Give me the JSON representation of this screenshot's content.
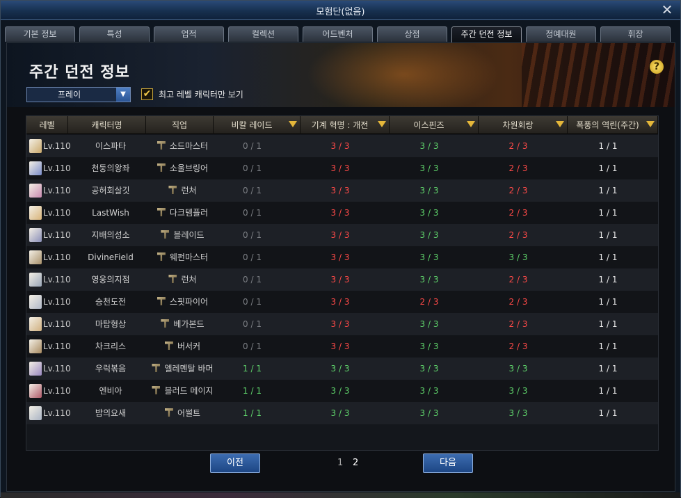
{
  "window": {
    "title": "모험단(없음)",
    "close_glyph": "✕"
  },
  "tabs": [
    {
      "label": "기본 정보",
      "active": false
    },
    {
      "label": "특성",
      "active": false
    },
    {
      "label": "업적",
      "active": false
    },
    {
      "label": "컬렉션",
      "active": false
    },
    {
      "label": "어드벤처",
      "active": false
    },
    {
      "label": "상점",
      "active": false
    },
    {
      "label": "주간 던전 정보",
      "active": true
    },
    {
      "label": "정예대원",
      "active": false
    },
    {
      "label": "휘장",
      "active": false
    }
  ],
  "panel": {
    "title": "주간 던전 정보",
    "help_glyph": "?",
    "server_dropdown": {
      "selected": "프레이",
      "arrow_glyph": "▼"
    },
    "checkbox": {
      "label": "최고 레벨 캐릭터만 보기",
      "checked": true,
      "check_glyph": "✔"
    }
  },
  "table": {
    "headers": [
      {
        "label": "레벨",
        "sortable": false
      },
      {
        "label": "캐릭터명",
        "sortable": false
      },
      {
        "label": "직업",
        "sortable": false
      },
      {
        "label": "비칼 레이드",
        "sortable": true
      },
      {
        "label": "기계 혁명 : 개전",
        "sortable": true
      },
      {
        "label": "이스핀즈",
        "sortable": true
      },
      {
        "label": "차원회랑",
        "sortable": true
      },
      {
        "label": "폭풍의 역린(주간)",
        "sortable": true
      }
    ],
    "rows": [
      {
        "level": "Lv.110",
        "name": "이스파타",
        "job": "소드마스터",
        "avatar_color": "#c9a86a",
        "vals": [
          {
            "t": "0 / 1",
            "c": "gray"
          },
          {
            "t": "3 / 3",
            "c": "red"
          },
          {
            "t": "3 / 3",
            "c": "green"
          },
          {
            "t": "2 / 3",
            "c": "red"
          },
          {
            "t": "1 / 1",
            "c": "white"
          }
        ]
      },
      {
        "level": "Lv.110",
        "name": "천둥의왕좌",
        "job": "소울브링어",
        "avatar_color": "#7a8cc9",
        "vals": [
          {
            "t": "0 / 1",
            "c": "gray"
          },
          {
            "t": "3 / 3",
            "c": "red"
          },
          {
            "t": "3 / 3",
            "c": "green"
          },
          {
            "t": "2 / 3",
            "c": "red"
          },
          {
            "t": "1 / 1",
            "c": "white"
          }
        ]
      },
      {
        "level": "Lv.110",
        "name": "공허회살깃",
        "job": "런처",
        "avatar_color": "#c98ab0",
        "vals": [
          {
            "t": "0 / 1",
            "c": "gray"
          },
          {
            "t": "3 / 3",
            "c": "red"
          },
          {
            "t": "3 / 3",
            "c": "green"
          },
          {
            "t": "2 / 3",
            "c": "red"
          },
          {
            "t": "1 / 1",
            "c": "white"
          }
        ]
      },
      {
        "level": "Lv.110",
        "name": "LastWish",
        "job": "다크템플러",
        "avatar_color": "#d8b47a",
        "vals": [
          {
            "t": "0 / 1",
            "c": "gray"
          },
          {
            "t": "3 / 3",
            "c": "red"
          },
          {
            "t": "3 / 3",
            "c": "green"
          },
          {
            "t": "2 / 3",
            "c": "red"
          },
          {
            "t": "1 / 1",
            "c": "white"
          }
        ]
      },
      {
        "level": "Lv.110",
        "name": "지배의성소",
        "job": "블레이드",
        "avatar_color": "#8a8fb8",
        "vals": [
          {
            "t": "0 / 1",
            "c": "gray"
          },
          {
            "t": "3 / 3",
            "c": "red"
          },
          {
            "t": "3 / 3",
            "c": "green"
          },
          {
            "t": "2 / 3",
            "c": "red"
          },
          {
            "t": "1 / 1",
            "c": "white"
          }
        ]
      },
      {
        "level": "Lv.110",
        "name": "DivineField",
        "job": "웨펀마스터",
        "avatar_color": "#a8906a",
        "vals": [
          {
            "t": "0 / 1",
            "c": "gray"
          },
          {
            "t": "3 / 3",
            "c": "red"
          },
          {
            "t": "3 / 3",
            "c": "green"
          },
          {
            "t": "3 / 3",
            "c": "green"
          },
          {
            "t": "1 / 1",
            "c": "white"
          }
        ]
      },
      {
        "level": "Lv.110",
        "name": "영웅의지점",
        "job": "런처",
        "avatar_color": "#9aa6b8",
        "vals": [
          {
            "t": "0 / 1",
            "c": "gray"
          },
          {
            "t": "3 / 3",
            "c": "red"
          },
          {
            "t": "3 / 3",
            "c": "green"
          },
          {
            "t": "2 / 3",
            "c": "red"
          },
          {
            "t": "1 / 1",
            "c": "white"
          }
        ]
      },
      {
        "level": "Lv.110",
        "name": "승천도전",
        "job": "스핏파이어",
        "avatar_color": "#b0b8c8",
        "vals": [
          {
            "t": "0 / 1",
            "c": "gray"
          },
          {
            "t": "3 / 3",
            "c": "red"
          },
          {
            "t": "2 / 3",
            "c": "red"
          },
          {
            "t": "2 / 3",
            "c": "red"
          },
          {
            "t": "1 / 1",
            "c": "white"
          }
        ]
      },
      {
        "level": "Lv.110",
        "name": "마탑형상",
        "job": "베가본드",
        "avatar_color": "#d0b080",
        "vals": [
          {
            "t": "0 / 1",
            "c": "gray"
          },
          {
            "t": "3 / 3",
            "c": "red"
          },
          {
            "t": "3 / 3",
            "c": "green"
          },
          {
            "t": "2 / 3",
            "c": "red"
          },
          {
            "t": "1 / 1",
            "c": "white"
          }
        ]
      },
      {
        "level": "Lv.110",
        "name": "차크리스",
        "job": "버서커",
        "avatar_color": "#a88a60",
        "vals": [
          {
            "t": "0 / 1",
            "c": "gray"
          },
          {
            "t": "3 / 3",
            "c": "red"
          },
          {
            "t": "3 / 3",
            "c": "green"
          },
          {
            "t": "2 / 3",
            "c": "red"
          },
          {
            "t": "1 / 1",
            "c": "white"
          }
        ]
      },
      {
        "level": "Lv.110",
        "name": "우럭볶음",
        "job": "엘레멘탈 바머",
        "avatar_color": "#9a88c0",
        "vals": [
          {
            "t": "1 / 1",
            "c": "green"
          },
          {
            "t": "3 / 3",
            "c": "green"
          },
          {
            "t": "3 / 3",
            "c": "green"
          },
          {
            "t": "3 / 3",
            "c": "green"
          },
          {
            "t": "1 / 1",
            "c": "white"
          }
        ]
      },
      {
        "level": "Lv.110",
        "name": "엔비아",
        "job": "블러드 메이지",
        "avatar_color": "#b05a6a",
        "vals": [
          {
            "t": "1 / 1",
            "c": "green"
          },
          {
            "t": "3 / 3",
            "c": "green"
          },
          {
            "t": "3 / 3",
            "c": "green"
          },
          {
            "t": "3 / 3",
            "c": "green"
          },
          {
            "t": "1 / 1",
            "c": "white"
          }
        ]
      },
      {
        "level": "Lv.110",
        "name": "밤의요새",
        "job": "어썰트",
        "avatar_color": "#aab4c4",
        "vals": [
          {
            "t": "1 / 1",
            "c": "green"
          },
          {
            "t": "3 / 3",
            "c": "green"
          },
          {
            "t": "3 / 3",
            "c": "green"
          },
          {
            "t": "3 / 3",
            "c": "green"
          },
          {
            "t": "1 / 1",
            "c": "white"
          }
        ]
      }
    ]
  },
  "pagination": {
    "prev_label": "이전",
    "next_label": "다음",
    "pages": [
      "1",
      "2"
    ],
    "current": "2"
  }
}
